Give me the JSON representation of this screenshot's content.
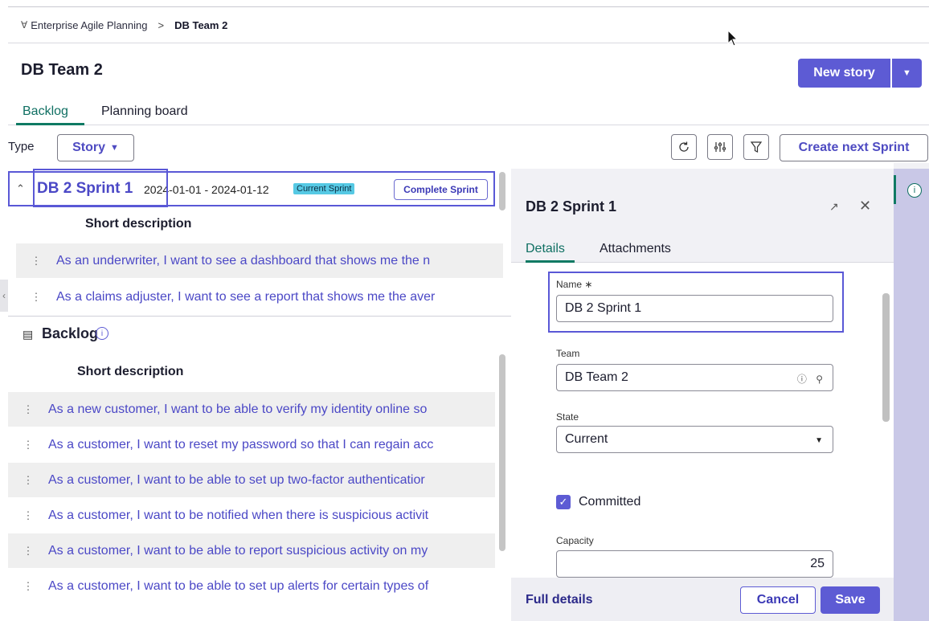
{
  "breadcrumb": {
    "parent_icon": "hierarchy-icon",
    "parent": "Enterprise Agile Planning",
    "separator": ">",
    "current": "DB Team 2"
  },
  "page": {
    "title": "DB Team 2",
    "new_story_label": "New story"
  },
  "tabs": [
    {
      "label": "Backlog",
      "active": true
    },
    {
      "label": "Planning board",
      "active": false
    }
  ],
  "toolbar": {
    "type_label": "Type",
    "type_value": "Story",
    "icons": [
      "refresh-icon",
      "settings-sliders-icon",
      "filter-icon"
    ],
    "create_sprint_label": "Create next Sprint"
  },
  "sprint": {
    "name": "DB 2 Sprint 1",
    "dates": "2024-01-01 - 2024-01-12",
    "badge": "Current Sprint",
    "complete_label": "Complete Sprint",
    "column_header": "Short description",
    "stories": [
      "As an underwriter, I want to see a dashboard that shows me the n",
      "As a claims adjuster, I want to see a report that shows me the aver"
    ]
  },
  "backlog": {
    "title": "Backlog",
    "column_header": "Short description",
    "stories": [
      "As a new customer, I want to be able to verify my identity online so",
      "As a customer, I want to reset my password so that I can regain acc",
      "As a customer, I want to be able to set up two-factor authenticatior",
      "As a customer, I want to be notified when there is suspicious activit",
      "As a customer, I want to be able to report suspicious activity on my",
      "As a customer, I want to be able to set up alerts for certain types of"
    ]
  },
  "detail_panel": {
    "title": "DB 2 Sprint 1",
    "tabs": [
      "Details",
      "Attachments"
    ],
    "name_label": "Name",
    "required_mark": "∗",
    "name_value": "DB 2 Sprint 1",
    "team_label": "Team",
    "team_value": "DB Team 2",
    "state_label": "State",
    "state_value": "Current",
    "committed_label": "Committed",
    "committed_checked": true,
    "capacity_label": "Capacity",
    "capacity_value": "25",
    "full_details_label": "Full details",
    "cancel_label": "Cancel",
    "save_label": "Save"
  },
  "colors": {
    "accent": "#5d5bd4",
    "link": "#4b48c6",
    "tab_active": "#0f7a63",
    "badge": "#56c9e4"
  }
}
